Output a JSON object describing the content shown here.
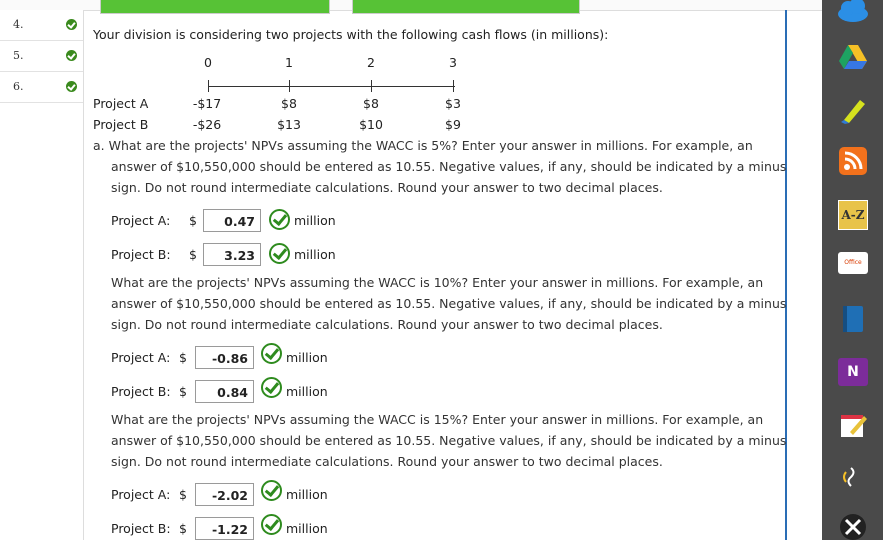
{
  "qnav": [
    {
      "num": "4."
    },
    {
      "num": "5."
    },
    {
      "num": "6."
    }
  ],
  "intro": "Your division is considering two projects with the following cash flows (in millions):",
  "timeline": [
    "0",
    "1",
    "2",
    "3"
  ],
  "projects": [
    {
      "name": "Project A",
      "flows": [
        "-$17",
        "$8",
        "$8",
        "$3"
      ]
    },
    {
      "name": "Project B",
      "flows": [
        "-$26",
        "$13",
        "$10",
        "$9"
      ]
    }
  ],
  "q_a": "a. What are the projects' NPVs assuming the WACC is 5%? Enter your answer in millions. For example, an",
  "q_a2": "answer of $10,550,000 should be entered as 10.55. Negative values, if any, should be indicated by a minus",
  "q_a3": "sign. Do not round intermediate calculations. Round your answer to two decimal places.",
  "q_b": "What are the projects' NPVs assuming the WACC is 10%? Enter your answer in millions. For example, an",
  "q_b2": "answer of $10,550,000 should be entered as 10.55. Negative values, if any, should be indicated by a minus",
  "q_b3": "sign. Do not round intermediate calculations. Round your answer to two decimal places.",
  "q_c": "What are the projects' NPVs assuming the WACC is 15%? Enter your answer in millions. For example, an",
  "q_c2": "answer of $10,550,000 should be entered as 10.55. Negative values, if any, should be indicated by a minus",
  "q_c3": "sign. Do not round intermediate calculations. Round your answer to two decimal places.",
  "labels": {
    "project_a_colon": "Project A:",
    "project_b_colon": "Project B:",
    "dollar": "$",
    "million": "million"
  },
  "answers": {
    "a5": "0.47",
    "b5": "3.23",
    "a10": "-0.86",
    "b10": "0.84",
    "a15": "-2.02",
    "b15": "-1.22"
  },
  "dock_icons": [
    "cloud-icon",
    "google-drive-icon",
    "highlighter-icon",
    "rss-icon",
    "a-z-icon",
    "office-icon",
    "book-icon",
    "onenote-icon",
    "notepad-icon",
    "voice-icon",
    "close-app-icon"
  ],
  "dock_text": {
    "az": "A-Z",
    "office": "Office",
    "onenote": "N"
  },
  "colors": {
    "accent": "#2a6db5",
    "check": "#2e8b1e",
    "progress": "#57c236"
  }
}
